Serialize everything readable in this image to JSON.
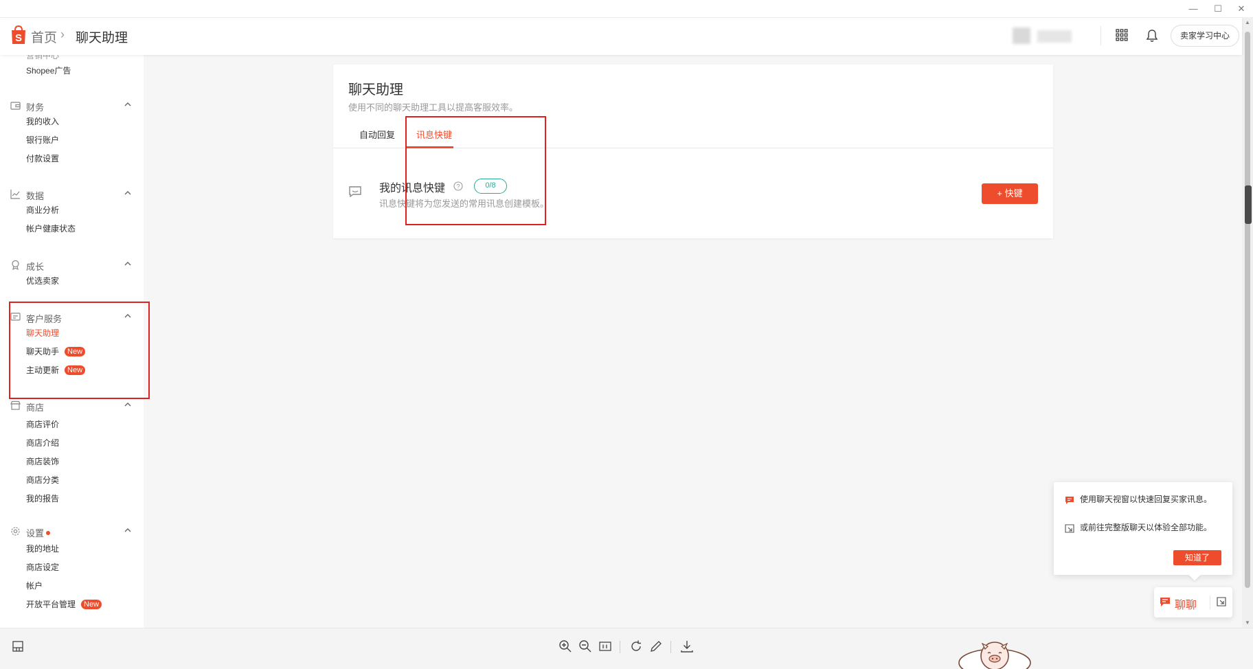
{
  "window": {
    "minimize": "—",
    "maximize": "☐",
    "close": "✕"
  },
  "header": {
    "breadcrumb_home": "首页",
    "breadcrumb_sep": "›",
    "breadcrumb_current": "聊天助理",
    "learning_center": "卖家学习中心"
  },
  "sidebar": {
    "partial_item": "营销中心",
    "shopee_ads": "Shopee广告",
    "finance": {
      "title": "财务",
      "items": [
        "我的收入",
        "银行账户",
        "付款设置"
      ]
    },
    "data": {
      "title": "数据",
      "items": [
        "商业分析",
        "帐户健康状态"
      ]
    },
    "growth": {
      "title": "成长",
      "items": [
        "优选卖家"
      ]
    },
    "customer_service": {
      "title": "客户服务",
      "items": [
        "聊天助理",
        "聊天助手",
        "主动更新"
      ],
      "new_badge": "New"
    },
    "shop": {
      "title": "商店",
      "items": [
        "商店评价",
        "商店介绍",
        "商店装饰",
        "商店分类",
        "我的报告"
      ]
    },
    "settings": {
      "title": "设置",
      "items": [
        "我的地址",
        "商店设定",
        "帐户",
        "开放平台管理"
      ],
      "new_badge": "New"
    }
  },
  "main": {
    "title": "聊天助理",
    "subtitle": "使用不同的聊天助理工具以提高客服效率。",
    "tabs": [
      "自动回复",
      "讯息快键"
    ],
    "active_tab": 1,
    "quick_replies": {
      "title": "我的讯息快键",
      "count": "0/8",
      "description": "讯息快键将为您发送的常用讯息创建模板。",
      "add_button": "+ 快键"
    }
  },
  "popover": {
    "line1": "使用聊天视窗以快速回复买家讯息。",
    "line2": "或前往完整版聊天以体验全部功能。",
    "button": "知道了"
  },
  "chat": {
    "label": "聊聊"
  },
  "colors": {
    "brand": "#ee4d2d",
    "teal": "#26aa99",
    "highlight": "#e02020"
  }
}
